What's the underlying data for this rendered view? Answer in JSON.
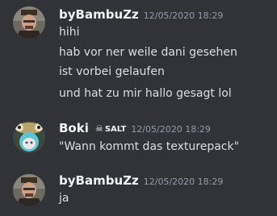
{
  "messages": [
    {
      "author": "byBambuZz",
      "timestamp": "12/05/2020 18:29",
      "lines": [
        "hihi",
        "hab vor ner weile dani gesehen",
        "ist vorbei gelaufen",
        "und hat zu mir hallo gesagt lol"
      ]
    },
    {
      "author": "Boki",
      "tag": "SALT",
      "timestamp": "12/05/2020 18:29",
      "lines": [
        "\"Wann kommt das texturepack\""
      ]
    },
    {
      "author": "byBambuZz",
      "timestamp": "12/05/2020 18:29",
      "lines": [
        "ja"
      ]
    }
  ],
  "colors": {
    "background": "#323339",
    "author": "#f2f3f5",
    "text": "#dbdee1",
    "timestamp": "#949ba4"
  }
}
